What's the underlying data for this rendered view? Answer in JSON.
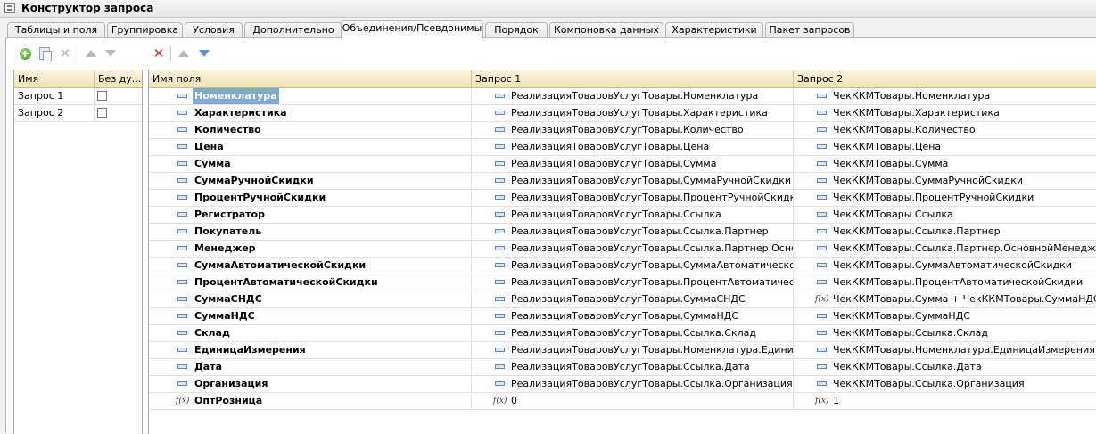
{
  "window": {
    "title": "Конструктор запроса"
  },
  "tabs": [
    {
      "label": "Таблицы и поля",
      "active": false
    },
    {
      "label": "Группировка",
      "active": false
    },
    {
      "label": "Условия",
      "active": false
    },
    {
      "label": "Дополнительно",
      "active": false
    },
    {
      "label": "Объединения/Псевдонимы",
      "active": true
    },
    {
      "label": "Порядок",
      "active": false
    },
    {
      "label": "Компоновка данных",
      "active": false
    },
    {
      "label": "Характеристики",
      "active": false
    },
    {
      "label": "Пакет запросов",
      "active": false
    }
  ],
  "left_toolbar": [
    "add-icon",
    "copy-icon",
    "delete-icon",
    "move-up-icon",
    "move-down-icon"
  ],
  "right_toolbar": [
    "delete-icon",
    "move-up-icon",
    "move-down-icon"
  ],
  "queries_table": {
    "columns": [
      "Имя",
      "Без ду..."
    ],
    "rows": [
      {
        "name": "Запрос 1",
        "no_duplicates": false
      },
      {
        "name": "Запрос 2",
        "no_duplicates": false
      }
    ]
  },
  "fields_table": {
    "columns": [
      "Имя поля",
      "Запрос 1",
      "Запрос 2"
    ],
    "rows": [
      {
        "name": "Номенклатура",
        "q1": "РеализацияТоваровУслугТовары.Номенклатура",
        "q2": "ЧекККМТовары.Номенклатура",
        "type": "field",
        "q1_type": "field",
        "q2_type": "field",
        "selected": true
      },
      {
        "name": "Характеристика",
        "q1": "РеализацияТоваровУслугТовары.Характеристика",
        "q2": "ЧекККМТовары.Характеристика",
        "type": "field",
        "q1_type": "field",
        "q2_type": "field"
      },
      {
        "name": "Количество",
        "q1": "РеализацияТоваровУслугТовары.Количество",
        "q2": "ЧекККМТовары.Количество",
        "type": "field",
        "q1_type": "field",
        "q2_type": "field"
      },
      {
        "name": "Цена",
        "q1": "РеализацияТоваровУслугТовары.Цена",
        "q2": "ЧекККМТовары.Цена",
        "type": "field",
        "q1_type": "field",
        "q2_type": "field"
      },
      {
        "name": "Сумма",
        "q1": "РеализацияТоваровУслугТовары.Сумма",
        "q2": "ЧекККМТовары.Сумма",
        "type": "field",
        "q1_type": "field",
        "q2_type": "field"
      },
      {
        "name": "СуммаРучнойСкидки",
        "q1": "РеализацияТоваровУслугТовары.СуммаРучнойСкидки",
        "q2": "ЧекККМТовары.СуммаРучнойСкидки",
        "type": "field",
        "q1_type": "field",
        "q2_type": "field"
      },
      {
        "name": "ПроцентРучнойСкидки",
        "q1": "РеализацияТоваровУслугТовары.ПроцентРучнойСкидки",
        "q2": "ЧекККМТовары.ПроцентРучнойСкидки",
        "type": "field",
        "q1_type": "field",
        "q2_type": "field"
      },
      {
        "name": "Регистратор",
        "q1": "РеализацияТоваровУслугТовары.Ссылка",
        "q2": "ЧекККМТовары.Ссылка",
        "type": "field",
        "q1_type": "field",
        "q2_type": "field"
      },
      {
        "name": "Покупатель",
        "q1": "РеализацияТоваровУслугТовары.Ссылка.Партнер",
        "q2": "ЧекККМТовары.Ссылка.Партнер",
        "type": "field",
        "q1_type": "field",
        "q2_type": "field"
      },
      {
        "name": "Менеджер",
        "q1": "РеализацияТоваровУслугТовары.Ссылка.Партнер.Основн...",
        "q2": "ЧекККМТовары.Ссылка.Партнер.ОсновнойМенеджер",
        "type": "field",
        "q1_type": "field",
        "q2_type": "field"
      },
      {
        "name": "СуммаАвтоматическойСкидки",
        "q1": "РеализацияТоваровУслугТовары.СуммаАвтоматическойС...",
        "q2": "ЧекККМТовары.СуммаАвтоматическойСкидки",
        "type": "field",
        "q1_type": "field",
        "q2_type": "field"
      },
      {
        "name": "ПроцентАвтоматическойСкидки",
        "q1": "РеализацияТоваровУслугТовары.ПроцентАвтоматическо...",
        "q2": "ЧекККМТовары.ПроцентАвтоматическойСкидки",
        "type": "field",
        "q1_type": "field",
        "q2_type": "field"
      },
      {
        "name": "СуммаСНДС",
        "q1": "РеализацияТоваровУслугТовары.СуммаСНДС",
        "q2": "ЧекККМТовары.Сумма + ЧекККМТовары.СуммаНДС",
        "type": "field",
        "q1_type": "field",
        "q2_type": "expr"
      },
      {
        "name": "СуммаНДС",
        "q1": "РеализацияТоваровУслугТовары.СуммаНДС",
        "q2": "ЧекККМТовары.СуммаНДС",
        "type": "field",
        "q1_type": "field",
        "q2_type": "field"
      },
      {
        "name": "Склад",
        "q1": "РеализацияТоваровУслугТовары.Ссылка.Склад",
        "q2": "ЧекККМТовары.Ссылка.Склад",
        "type": "field",
        "q1_type": "field",
        "q2_type": "field"
      },
      {
        "name": "ЕдиницаИзмерения",
        "q1": "РеализацияТоваровУслугТовары.Номенклатура.Единица...",
        "q2": "ЧекККМТовары.Номенклатура.ЕдиницаИзмерения",
        "type": "field",
        "q1_type": "field",
        "q2_type": "field"
      },
      {
        "name": "Дата",
        "q1": "РеализацияТоваровУслугТовары.Ссылка.Дата",
        "q2": "ЧекККМТовары.Ссылка.Дата",
        "type": "field",
        "q1_type": "field",
        "q2_type": "field"
      },
      {
        "name": "Организация",
        "q1": "РеализацияТоваровУслугТовары.Ссылка.Организация",
        "q2": "ЧекККМТовары.Ссылка.Организация",
        "type": "field",
        "q1_type": "field",
        "q2_type": "field"
      },
      {
        "name": "ОптРозница",
        "q1": "0",
        "q2": "1",
        "type": "expr",
        "q1_type": "expr",
        "q2_type": "expr"
      }
    ]
  },
  "icons": {
    "field": "field-icon",
    "expr": "expression-icon"
  },
  "colors": {
    "header_bg": "#f2e8c4",
    "selection": "#7fa7d8",
    "add_green": "#3e9a24",
    "delete_red": "#d03535",
    "arrow_blue": "#5c8fd0"
  }
}
